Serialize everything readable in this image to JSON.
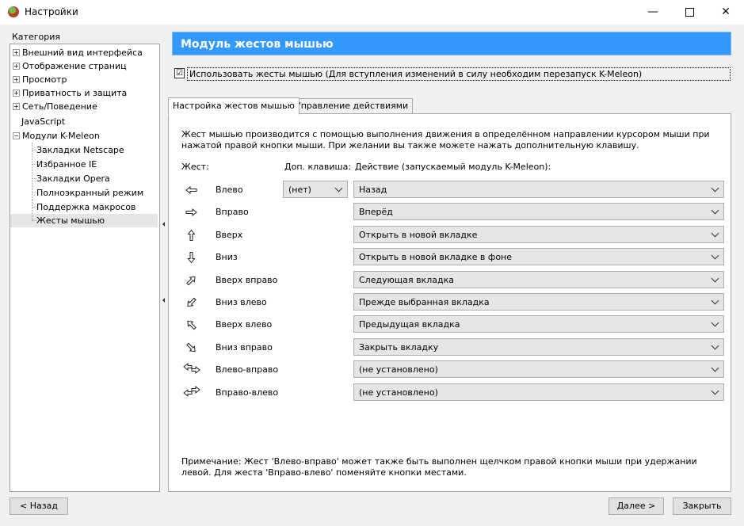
{
  "window": {
    "title": "Настройки"
  },
  "sidebar": {
    "category_label": "Категория",
    "items": [
      {
        "label": "Внешний вид интерфейса",
        "expander": "+"
      },
      {
        "label": "Отображение страниц",
        "expander": "+"
      },
      {
        "label": "Просмотр",
        "expander": "+"
      },
      {
        "label": "Приватность и защита",
        "expander": "+"
      },
      {
        "label": "Сеть/Поведение",
        "expander": "+"
      },
      {
        "label": "JavaScript"
      },
      {
        "label": "Модули K-Meleon",
        "expander": "−"
      },
      {
        "label": "Закладки Netscape"
      },
      {
        "label": "Избранное IE"
      },
      {
        "label": "Закладки Opera"
      },
      {
        "label": "Полноэкранный режим"
      },
      {
        "label": "Поддержка макросов"
      },
      {
        "label": "Жесты мышью",
        "selected": true
      }
    ]
  },
  "header": {
    "title": "Модуль жестов мышью"
  },
  "use_gestures": {
    "checked": true,
    "mark": "☑",
    "label": "Использовать жесты мышью (Для вступления изменений в силу необходим перезапуск K-Meleon)"
  },
  "tabs": [
    {
      "label": "Настройка жестов мышью",
      "active": true
    },
    {
      "label": "Управление действиями",
      "active": false
    }
  ],
  "panel": {
    "description": "Жест мышью производится с помощью выполнения движения в определённом направлении курсором мыши при нажатой правой кнопки мыши. При желании вы также можете нажать дополнительную клавишу.",
    "columns": {
      "gesture": "Жест:",
      "modifier": "Доп. клавиша:",
      "action": "Действие (запускаемый модуль K-Meleon):"
    },
    "modifier_value": "(нет)",
    "gestures": [
      {
        "name": "Влево",
        "icon": "arrow-left-icon",
        "action": "Назад"
      },
      {
        "name": "Вправо",
        "icon": "arrow-right-icon",
        "action": "Вперёд"
      },
      {
        "name": "Вверх",
        "icon": "arrow-up-icon",
        "action": "Открыть в новой вкладке"
      },
      {
        "name": "Вниз",
        "icon": "arrow-down-icon",
        "action": "Открыть в новой вкладке в фоне"
      },
      {
        "name": "Вверх вправо",
        "icon": "arrow-up-right-icon",
        "action": "Следующая вкладка"
      },
      {
        "name": "Вниз влево",
        "icon": "arrow-down-left-icon",
        "action": "Прежде выбранная вкладка"
      },
      {
        "name": "Вверх влево",
        "icon": "arrow-up-left-icon",
        "action": "Предыдущая вкладка"
      },
      {
        "name": "Вниз вправо",
        "icon": "arrow-down-right-icon",
        "action": "Закрыть вкладку"
      },
      {
        "name": "Влево-вправо",
        "icon": "arrow-left-right-icon",
        "action": "(не установлено)"
      },
      {
        "name": "Вправо-влево",
        "icon": "arrow-right-left-icon",
        "action": "(не установлено)"
      }
    ],
    "note": "Примечание: Жест 'Влево-вправо' может также быть выполнен щелчком правой кнопки мыши при удержании левой. Для жеста 'Вправо-влево' поменяйте кнопки местами."
  },
  "footer": {
    "back": "< Назад",
    "next": "Далее >",
    "close": "Закрыть"
  }
}
